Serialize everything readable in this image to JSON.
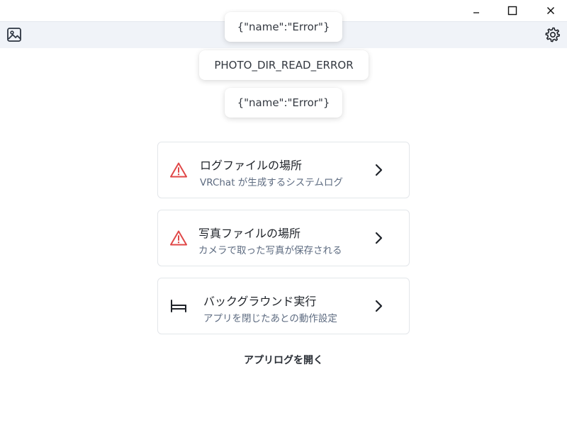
{
  "window": {
    "minimize_label": "–",
    "maximize_icon": "maximize-icon",
    "close_label": "✕"
  },
  "toolbar": {
    "left_icon": "gallery-icon",
    "right_icon": "gear-icon"
  },
  "toasts": [
    {
      "text": "{\"name\":\"Error\"}"
    },
    {
      "text": "PHOTO_DIR_READ_ERROR"
    },
    {
      "text": "{\"name\":\"Error\"}"
    }
  ],
  "settings": {
    "items": [
      {
        "icon": "warning-triangle-icon",
        "title": "ログファイルの場所",
        "subtitle": "VRChat が生成するシステムログ",
        "status_color": "#e04848"
      },
      {
        "icon": "warning-triangle-icon",
        "title": "写真ファイルの場所",
        "subtitle": "カメラで取った写真が保存される",
        "status_color": "#e04848"
      },
      {
        "icon": "bed-icon",
        "title": "バックグラウンド実行",
        "subtitle": "アプリを閉じたあとの動作設定"
      }
    ]
  },
  "footer": {
    "open_app_log": "アプリログを開く"
  }
}
